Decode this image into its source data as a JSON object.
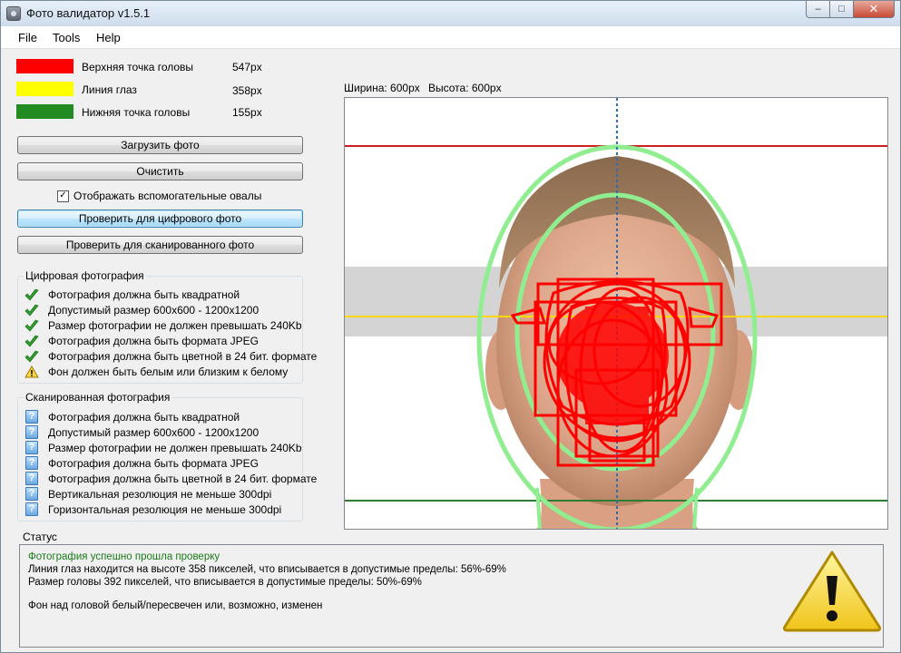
{
  "window": {
    "title": "Фото валидатор v1.5.1",
    "min_glyph": "‒",
    "max_glyph": "□",
    "close_glyph": "✕"
  },
  "menu": {
    "file": "File",
    "tools": "Tools",
    "help": "Help"
  },
  "legend": [
    {
      "label": "Верхняя точка головы",
      "value": "547px",
      "color": "#ff0000"
    },
    {
      "label": "Линия глаз",
      "value": "358px",
      "color": "#ffff00"
    },
    {
      "label": "Нижняя точка головы",
      "value": "155px",
      "color": "#228b22"
    }
  ],
  "buttons": {
    "load": "Загрузить фото",
    "clear": "Очистить",
    "check_digital": "Проверить для цифрового фото",
    "check_scanned": "Проверить для сканированного фото"
  },
  "checkbox": {
    "label": "Отображать вспомогательные овалы",
    "checked": true,
    "mark": "✓"
  },
  "digital_group": {
    "title": "Цифровая фотография",
    "items": [
      {
        "text": "Фотография должна быть квадратной",
        "icon": "green-check-icon"
      },
      {
        "text": "Допустимый размер 600x600 - 1200x1200",
        "icon": "green-check-icon"
      },
      {
        "text": "Размер фотографии не должен превышать 240Kb",
        "icon": "green-check-icon"
      },
      {
        "text": "Фотография должна быть формата JPEG",
        "icon": "green-check-icon"
      },
      {
        "text": "Фотография должна быть цветной в 24 бит. формате",
        "icon": "green-check-icon"
      },
      {
        "text": "Фон должен быть белым или близким к белому",
        "icon": "warning-icon"
      }
    ]
  },
  "scanned_group": {
    "title": "Сканированная фотография",
    "q_glyph": "?",
    "items": [
      {
        "text": "Фотография должна быть квадратной",
        "icon": "question-icon"
      },
      {
        "text": "Допустимый размер 600x600 - 1200x1200",
        "icon": "question-icon"
      },
      {
        "text": "Размер фотографии не должен превышать 240Kb",
        "icon": "question-icon"
      },
      {
        "text": "Фотография должна быть формата JPEG",
        "icon": "question-icon"
      },
      {
        "text": "Фотография должна быть цветной в 24 бит. формате",
        "icon": "question-icon"
      },
      {
        "text": "Вертикальная резолюция не меньше 300dpi",
        "icon": "question-icon"
      },
      {
        "text": "Горизонтальная резолюция не меньше 300dpi",
        "icon": "question-icon"
      }
    ]
  },
  "photo": {
    "width_label": "Ширина: 600px",
    "height_label": "Высота: 600px"
  },
  "status": {
    "title": "Статус",
    "success": "Фотография успешно прошла проверку",
    "line1": "Линия глаз находится на высоте 358 пикселей, что вписывается в допустимые пределы: 56%-69%",
    "line2": "Размер головы 392 пикселей, что вписывается в допустимые пределы: 50%-69%",
    "line3": "Фон над головой белый/пересвечен или, возможно, изменен",
    "big_icon": "warning-icon"
  },
  "colors": {
    "success_text": "#1a7a1a",
    "guide_oval": "#90ee90",
    "marker_red": "#ff0000"
  }
}
